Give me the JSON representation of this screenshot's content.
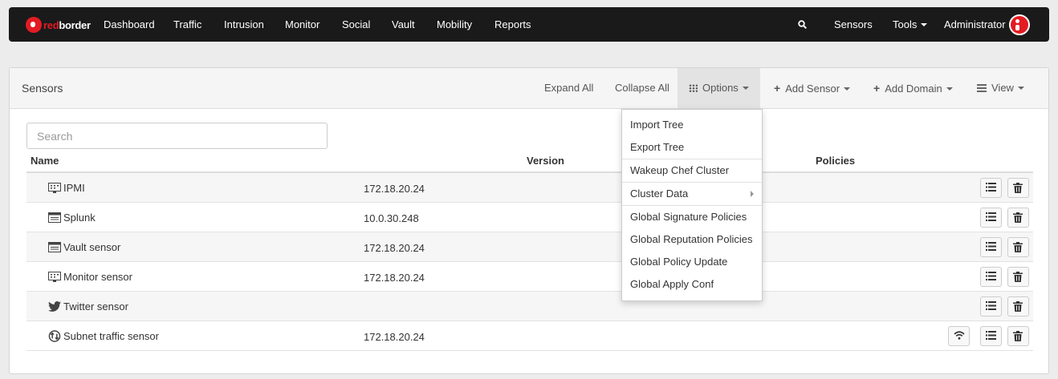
{
  "navbar": {
    "brand_red": "red",
    "brand_white": "border",
    "items": [
      "Dashboard",
      "Traffic",
      "Intrusion",
      "Monitor",
      "Social",
      "Vault",
      "Mobility",
      "Reports"
    ],
    "right": {
      "sensors": "Sensors",
      "tools": "Tools",
      "user": "Administrator"
    }
  },
  "panel": {
    "title": "Sensors",
    "actions": {
      "expand_all": "Expand All",
      "collapse_all": "Collapse All",
      "options": "Options",
      "add_sensor": "Add Sensor",
      "add_domain": "Add Domain",
      "view": "View"
    },
    "search_placeholder": "Search",
    "columns": {
      "name": "Name",
      "version": "Version",
      "policies": "Policies"
    },
    "rows": [
      {
        "name": "IPMI",
        "ip": "172.18.20.24",
        "icon": "monitor-icon"
      },
      {
        "name": "Splunk",
        "ip": "10.0.30.248",
        "icon": "server-icon"
      },
      {
        "name": "Vault sensor",
        "ip": "172.18.20.24",
        "icon": "server-icon"
      },
      {
        "name": "Monitor sensor",
        "ip": "172.18.20.24",
        "icon": "monitor-icon"
      },
      {
        "name": "Twitter sensor",
        "ip": "",
        "icon": "twitter-icon"
      },
      {
        "name": "Subnet traffic sensor",
        "ip": "172.18.20.24",
        "icon": "traffic-icon"
      }
    ]
  },
  "options_menu": {
    "items": [
      "Import Tree",
      "Export Tree",
      "Wakeup Chef Cluster",
      "Cluster Data",
      "Global Signature Policies",
      "Global Reputation Policies",
      "Global Policy Update",
      "Global Apply Conf"
    ]
  },
  "colors": {
    "brand": "#e31b23",
    "navbar_bg": "#1a1a1a",
    "page_bg": "#ececec"
  }
}
